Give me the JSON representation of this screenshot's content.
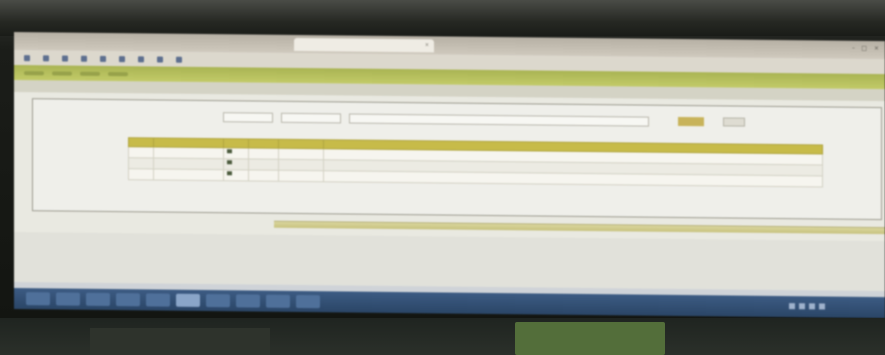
{
  "browser": {
    "tab_title": "",
    "close_glyph": "×",
    "window_controls": [
      "–",
      "□",
      "×"
    ],
    "bookmarks": [
      "",
      "",
      "",
      "",
      "",
      "",
      "",
      "",
      ""
    ]
  },
  "app": {
    "nav_items": [
      "",
      "",
      "",
      ""
    ],
    "breadcrumb": ""
  },
  "search": {
    "field_1": "",
    "field_2": "",
    "field_3": "",
    "search_label": "",
    "clear_label": ""
  },
  "pager_top": {
    "left": "",
    "right": ""
  },
  "pager_bottom": {
    "left": "",
    "right": ""
  },
  "table": {
    "headers": [
      "",
      "",
      "",
      "",
      "",
      ""
    ],
    "rows": [
      [
        "",
        "",
        "",
        "",
        "",
        ""
      ],
      [
        "",
        "",
        "",
        "",
        "",
        ""
      ],
      [
        "",
        "",
        "",
        "",
        "",
        ""
      ]
    ]
  },
  "taskbar": {
    "item_count": 12,
    "active_index": 5,
    "clock": ""
  },
  "colors": {
    "nav_green": "#a9b453",
    "table_header": "#c7bb49",
    "taskbar_blue": "#2a4566"
  }
}
